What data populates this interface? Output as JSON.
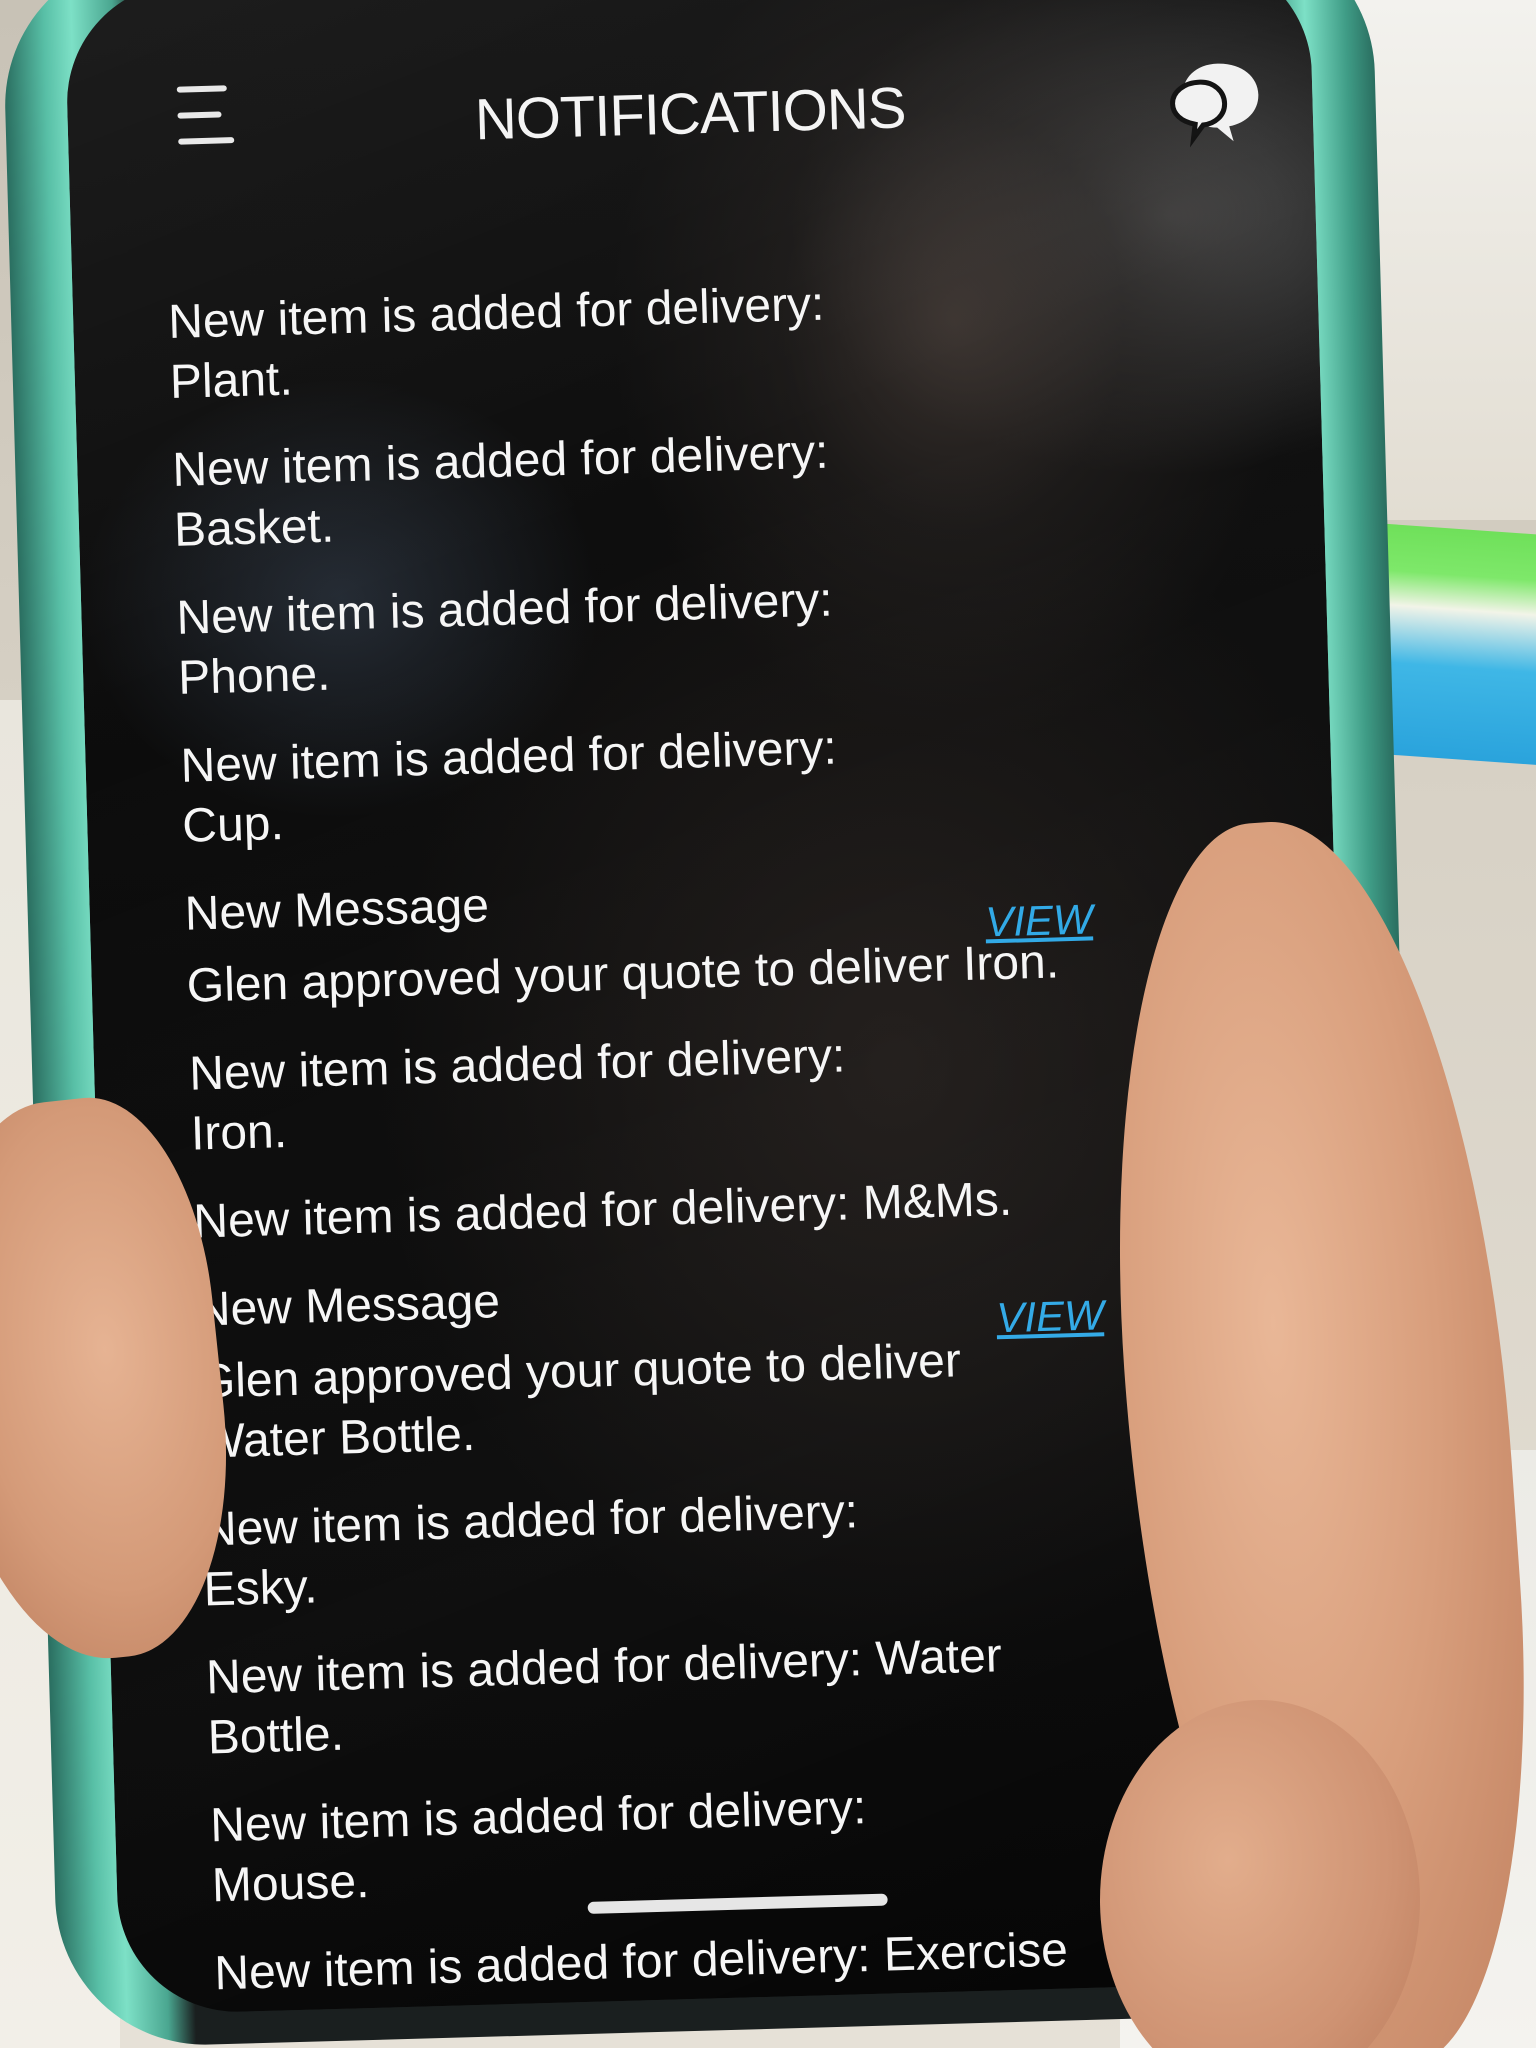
{
  "header": {
    "title": "NOTIFICATIONS",
    "menu_icon": "hamburger-menu-icon",
    "chat_icon": "chat-bubbles-icon"
  },
  "notifications": [
    {
      "text": "New item is added for delivery: Plant."
    },
    {
      "text": "New item is added for delivery: Basket."
    },
    {
      "text": "New item is added for delivery: Phone."
    },
    {
      "text": "New item is added for delivery: Cup."
    },
    {
      "text": "New Message",
      "action_label": "VIEW"
    },
    {
      "text": "Glen approved your quote to deliver Iron."
    },
    {
      "text": "New item is added for delivery: Iron."
    },
    {
      "text": "New item is added for delivery: M&Ms."
    },
    {
      "text": "New Message",
      "action_label": "VIEW"
    },
    {
      "text": "Glen approved your quote to deliver Water Bottle."
    },
    {
      "text": "New item is added for delivery: Esky."
    },
    {
      "text": "New item is added for delivery: Water Bottle."
    },
    {
      "text": "New item is added for delivery: Mouse."
    },
    {
      "text": "New item is added for delivery: Exercise Ball."
    }
  ],
  "colors": {
    "link": "#2ea8e6",
    "text": "#f6f6f6",
    "screen_bg": "#050505",
    "phone_case": "#7de0c6"
  }
}
